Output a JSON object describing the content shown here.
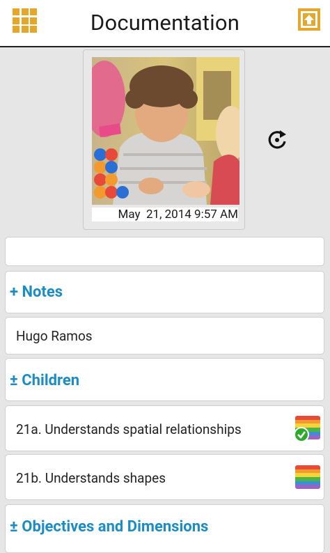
{
  "header": {
    "title": "Documentation"
  },
  "photo": {
    "date": "May  21, 2014 9:57 AM"
  },
  "notes": {
    "label": "+ Notes"
  },
  "child": {
    "name": "Hugo Ramos"
  },
  "children": {
    "label": "± Children"
  },
  "objectives": [
    {
      "label": "21a. Understands spatial relationships",
      "completed": true
    },
    {
      "label": "21b. Understands shapes",
      "completed": false
    }
  ],
  "objectives_section": {
    "label": "± Objectives and Dimensions"
  },
  "colors": {
    "accent": "#e5a72a",
    "section_blue": "#1b8cc4",
    "check_green": "#2daa2d",
    "rainbow": [
      "#e84a3a",
      "#f39a2e",
      "#f6d33a",
      "#4bb543",
      "#3c8fd6",
      "#9b63c4"
    ]
  },
  "icons": {
    "menu": "grid-icon",
    "share": "share-export-icon",
    "rotate": "rotate-icon",
    "flag": "rainbow-flag-icon",
    "check": "checkmark-icon"
  }
}
